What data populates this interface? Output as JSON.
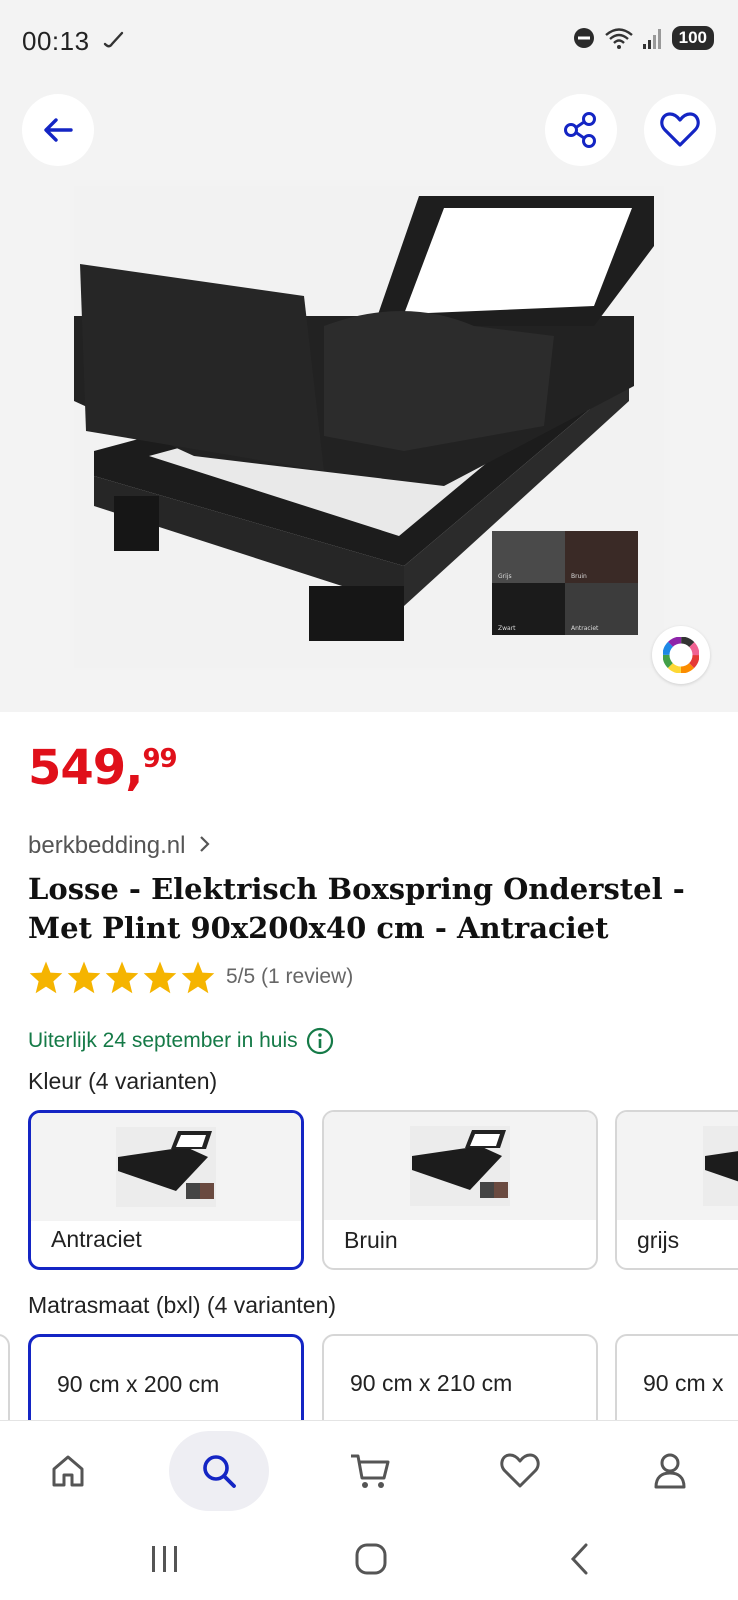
{
  "status_bar": {
    "time": "00:13",
    "battery": "100"
  },
  "product": {
    "price_main": "549,",
    "price_cents": "99",
    "seller": "berkbedding.nl",
    "title": "Losse - Elektrisch Boxspring Onderstel - Met Plint 90x200x40 cm - Antraciet",
    "rating_value": 5,
    "rating_text": "5/5 (1 review)",
    "delivery": "Uiterlijk 24 september in huis",
    "swatches": [
      "Grijs",
      "Bruin",
      "Zwart",
      "Antraciet"
    ]
  },
  "colors": {
    "label": "Kleur (4 varianten)",
    "options": [
      "Antraciet",
      "Bruin",
      "grijs"
    ],
    "selected": "Antraciet"
  },
  "sizes": {
    "label": "Matrasmaat (bxl) (4 varianten)",
    "options": [
      "90 cm x 200 cm",
      "90 cm x 210 cm",
      "90 cm x"
    ],
    "selected": "90 cm x 200 cm"
  },
  "theme": {
    "accent": "#1425c4",
    "price": "#e0101a",
    "delivery": "#157a47",
    "star": "#f5b400"
  },
  "nav": {
    "items": [
      "home-icon",
      "search-icon",
      "cart-icon",
      "heart-icon",
      "user-icon"
    ],
    "active": "search-icon"
  }
}
